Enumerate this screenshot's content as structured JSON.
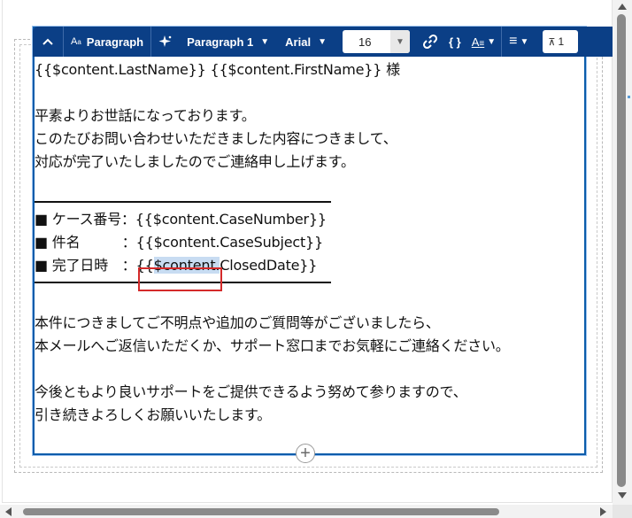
{
  "toolbar": {
    "style_label": "Paragraph",
    "block_label": "Paragraph 1",
    "font_label": "Arial",
    "size_value": "16",
    "braces_label": "{ }",
    "last_value": "1"
  },
  "content": {
    "lines": [
      "{{$content.LastName}} {{$content.FirstName}} 様",
      "",
      "平素よりお世話になっております。",
      "このたびお問い合わせいただきました内容につきまして、",
      "対応が完了いたしましたのでご連絡申し上げます。"
    ],
    "case_number": "■ ケース番号：{{$content.CaseNumber}}",
    "case_subject": "■ 件名　　　：{{$content.CaseSubject}}",
    "closed_prefix": "■ 完了日時　：{{",
    "closed_highlight": "$content.",
    "closed_suffix": "ClosedDate}}",
    "closing_lines": [
      "本件につきましてご不明点や追加のご質問等がございましたら、",
      "本メールへご返信いただくか、サポート窓口までお気軽にご連絡ください。",
      "",
      "今後ともより良いサポートをご提供できるよう努めて参りますので、",
      "引き続きよろしくお願いいたします。"
    ]
  },
  "icons": {
    "collapse": "chevron-up-icon",
    "style": "text-style-icon",
    "ai": "sparkle-icon",
    "link": "link-icon",
    "highlight": "text-highlight-icon",
    "align": "align-icon",
    "insert": "add-block-icon"
  },
  "colors": {
    "toolbar_bg": "#0b3f86",
    "editor_border": "#0b5cab",
    "selection": "#c8dcf2",
    "annotation": "#d42a2a"
  }
}
